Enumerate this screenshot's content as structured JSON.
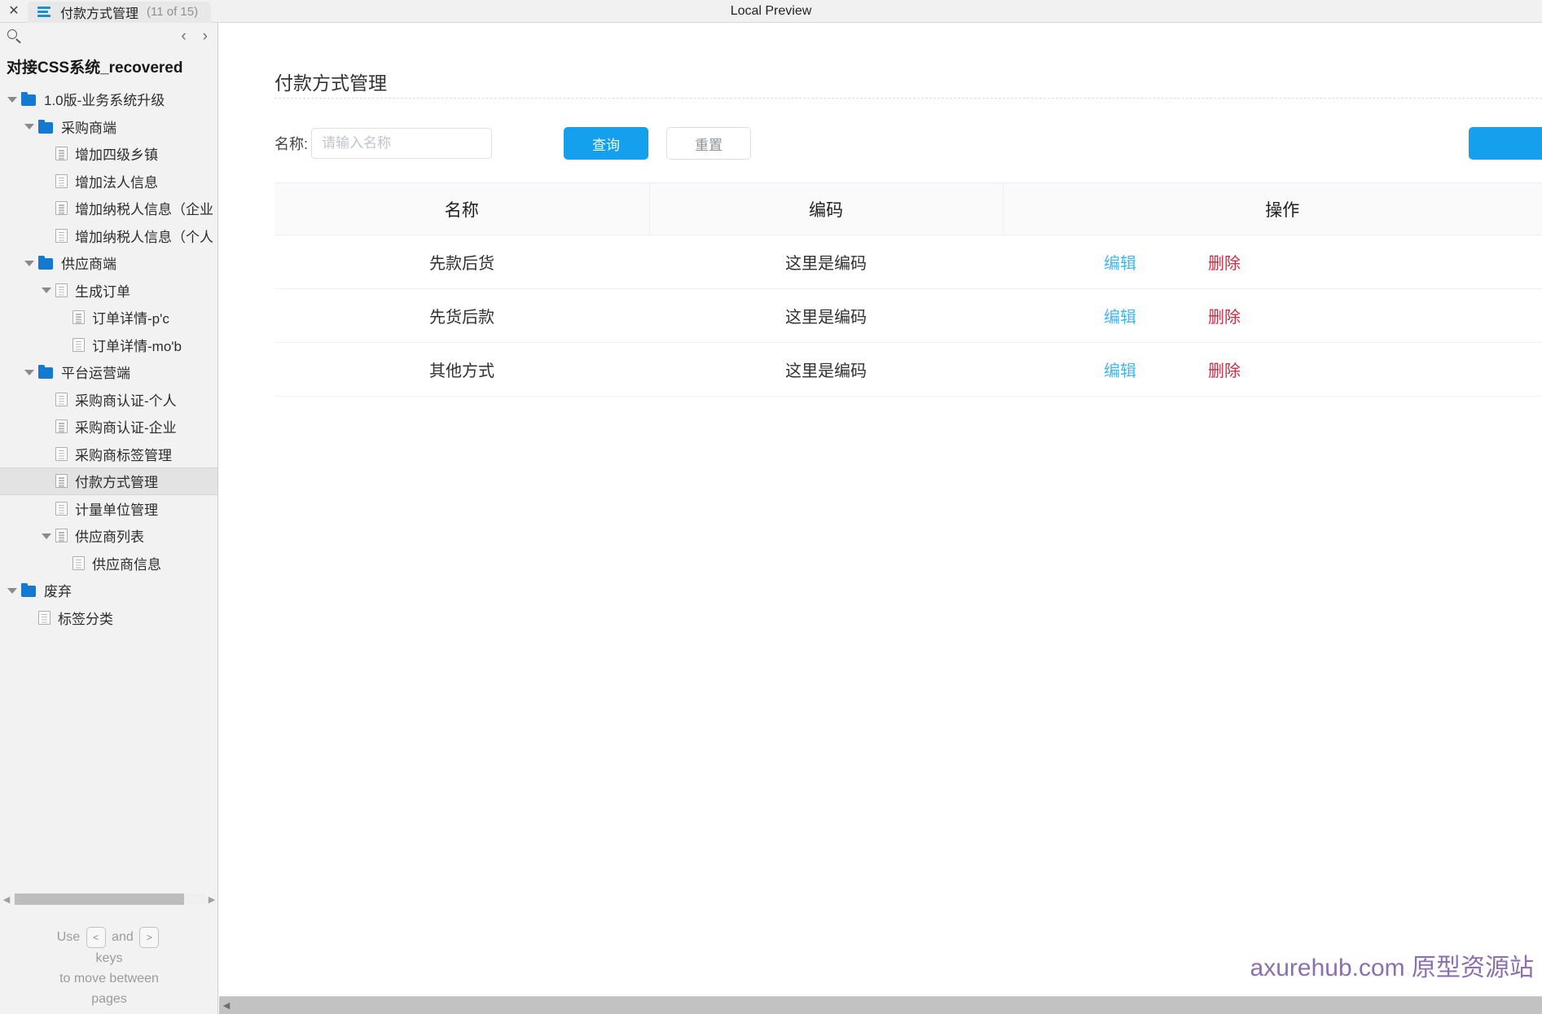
{
  "window": {
    "tab_title": "付款方式管理",
    "tab_count": "(11 of 15)",
    "preview_label": "Local Preview",
    "close_glyph": "✕",
    "menu_icon": "list-icon"
  },
  "sidebar": {
    "search_icon": "search-icon",
    "prev_glyph": "‹",
    "next_glyph": "›",
    "project_title": "对接CSS系统_recovered",
    "tree": [
      {
        "label": "1.0版-业务系统升级",
        "icon": "folder",
        "indent": 0,
        "caret": true,
        "selected": false
      },
      {
        "label": "采购商端",
        "icon": "folder",
        "indent": 1,
        "caret": true,
        "selected": false
      },
      {
        "label": "增加四级乡镇",
        "icon": "page",
        "indent": 2,
        "caret": false,
        "selected": false
      },
      {
        "label": "增加法人信息",
        "icon": "page",
        "indent": 2,
        "caret": false,
        "selected": false
      },
      {
        "label": "增加纳税人信息（企业）",
        "icon": "page",
        "indent": 2,
        "caret": false,
        "selected": false
      },
      {
        "label": "增加纳税人信息（个人）",
        "icon": "page",
        "indent": 2,
        "caret": false,
        "selected": false
      },
      {
        "label": "供应商端",
        "icon": "folder",
        "indent": 1,
        "caret": true,
        "selected": false
      },
      {
        "label": "生成订单",
        "icon": "page",
        "indent": 2,
        "caret": true,
        "selected": false
      },
      {
        "label": "订单详情-p'c",
        "icon": "page",
        "indent": 3,
        "caret": false,
        "selected": false
      },
      {
        "label": "订单详情-mo'b",
        "icon": "page",
        "indent": 3,
        "caret": false,
        "selected": false
      },
      {
        "label": "平台运营端",
        "icon": "folder",
        "indent": 1,
        "caret": true,
        "selected": false
      },
      {
        "label": "采购商认证-个人",
        "icon": "page",
        "indent": 2,
        "caret": false,
        "selected": false
      },
      {
        "label": "采购商认证-企业",
        "icon": "page",
        "indent": 2,
        "caret": false,
        "selected": false
      },
      {
        "label": "采购商标签管理",
        "icon": "page",
        "indent": 2,
        "caret": false,
        "selected": false
      },
      {
        "label": "付款方式管理",
        "icon": "page",
        "indent": 2,
        "caret": false,
        "selected": true
      },
      {
        "label": "计量单位管理",
        "icon": "page",
        "indent": 2,
        "caret": false,
        "selected": false
      },
      {
        "label": "供应商列表",
        "icon": "page",
        "indent": 2,
        "caret": true,
        "selected": false
      },
      {
        "label": "供应商信息",
        "icon": "page",
        "indent": 3,
        "caret": false,
        "selected": false
      },
      {
        "label": "废弃",
        "icon": "folder",
        "indent": 0,
        "caret": true,
        "selected": false
      },
      {
        "label": "标签分类",
        "icon": "page",
        "indent": 1,
        "caret": false,
        "selected": false
      }
    ],
    "hint": {
      "use": "Use",
      "and": "and",
      "key_prev": "<",
      "key_next": ">",
      "keys_word": "keys",
      "line3": "to move between",
      "line4": "pages"
    }
  },
  "main": {
    "page_title": "付款方式管理",
    "filter": {
      "name_label": "名称:",
      "name_value": "",
      "name_placeholder": "请输入名称",
      "search_button": "查询",
      "reset_button": "重置",
      "add_button": ""
    },
    "table": {
      "columns": [
        "名称",
        "编码",
        "操作"
      ],
      "rows": [
        {
          "name": "先款后货",
          "code": "这里是编码",
          "edit": "编辑",
          "delete": "删除"
        },
        {
          "name": "先货后款",
          "code": "这里是编码",
          "edit": "编辑",
          "delete": "删除"
        },
        {
          "name": "其他方式",
          "code": "这里是编码",
          "edit": "编辑",
          "delete": "删除"
        }
      ]
    },
    "watermark": "axurehub.com 原型资源站"
  },
  "colors": {
    "primary": "#14a0ec",
    "edit_link": "#44b6ef",
    "delete_link": "#cc2b45",
    "watermark": "#8c6fae",
    "folder": "#1479d0"
  }
}
